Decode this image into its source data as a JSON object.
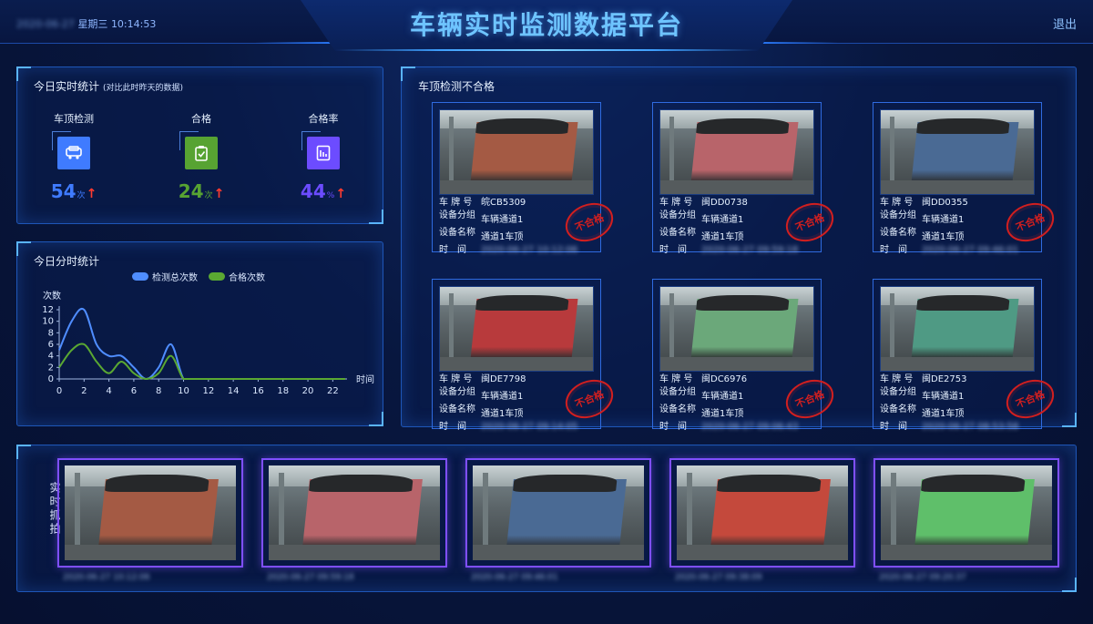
{
  "header": {
    "date": "2020-06-27",
    "weekday": "星期三",
    "time": "10:14:53",
    "title": "车辆实时监测数据平台",
    "logout": "退出"
  },
  "today_stats": {
    "title": "今日实时统计",
    "subtitle": "(对比此时昨天的数据)",
    "items": [
      {
        "label": "车顶检测",
        "value": "54",
        "unit": "次",
        "color": "#3f7bff",
        "icon": "truck-icon"
      },
      {
        "label": "合格",
        "value": "24",
        "unit": "次",
        "color": "#57a332",
        "icon": "clipboard-check-icon"
      },
      {
        "label": "合格率",
        "value": "44",
        "unit": "%",
        "color": "#6c4cff",
        "icon": "report-icon"
      }
    ]
  },
  "hourly_stats": {
    "title": "今日分时统计"
  },
  "chart_data": {
    "type": "line",
    "title": "",
    "ylabel": "次数",
    "xlabel": "时间",
    "x": [
      0,
      1,
      2,
      3,
      4,
      5,
      6,
      7,
      8,
      9,
      10,
      11,
      12,
      13,
      14,
      15,
      16,
      17,
      18,
      19,
      20,
      21,
      22,
      23
    ],
    "xticks": [
      "0",
      "2",
      "4",
      "6",
      "8",
      "10",
      "12",
      "14",
      "16",
      "18",
      "20",
      "22"
    ],
    "yticks": [
      "0",
      "2",
      "4",
      "6",
      "8",
      "10",
      "12"
    ],
    "ylim": [
      0,
      12
    ],
    "xlim": [
      0,
      23
    ],
    "series": [
      {
        "name": "检测总次数",
        "color": "#4f8dff",
        "values": [
          5,
          10,
          12,
          6,
          4,
          4,
          2,
          0,
          2,
          6,
          0,
          0,
          0,
          0,
          0,
          0,
          0,
          0,
          0,
          0,
          0,
          0,
          0,
          0
        ]
      },
      {
        "name": "合格次数",
        "color": "#5aa832",
        "values": [
          2,
          5,
          6,
          3,
          1,
          3,
          1,
          0,
          1,
          4,
          0,
          0,
          0,
          0,
          0,
          0,
          0,
          0,
          0,
          0,
          0,
          0,
          0,
          0
        ]
      }
    ],
    "legend": "top"
  },
  "inspection": {
    "title": "车顶检测不合格",
    "labels": {
      "plate": "车 牌 号",
      "group": "设备分组",
      "device": "设备名称",
      "time": "时　间"
    },
    "stamp": "不合格",
    "cards": [
      {
        "plate": "皖CB5309",
        "group": "车辆通道1",
        "device": "通道1车顶",
        "time": "2020-06-27 10:12:06",
        "color": "#a45a44"
      },
      {
        "plate": "闽DD0738",
        "group": "车辆通道1",
        "device": "通道1车顶",
        "time": "2020-06-27 09:59:18",
        "color": "#b8646a"
      },
      {
        "plate": "闽DD0355",
        "group": "车辆通道1",
        "device": "通道1车顶",
        "time": "2020-06-27 09:46:01",
        "color": "#4a6a94"
      },
      {
        "plate": "闽DE7798",
        "group": "车辆通道1",
        "device": "通道1车顶",
        "time": "2020-06-27 09:14:05",
        "color": "#b83a3c"
      },
      {
        "plate": "闽DC6976",
        "group": "车辆通道1",
        "device": "通道1车顶",
        "time": "2020-06-27 09:06:43",
        "color": "#6ba87a"
      },
      {
        "plate": "闽DE2753",
        "group": "车辆通道1",
        "device": "通道1车顶",
        "time": "2020-06-27 08:53:58",
        "color": "#4f9a84"
      }
    ]
  },
  "capture": {
    "title": "实时抓拍",
    "items": [
      {
        "time": "2020-06-27 10:12:06",
        "color": "#a45a44"
      },
      {
        "time": "2020-06-27 09:59:18",
        "color": "#b8646a"
      },
      {
        "time": "2020-06-27 09:46:01",
        "color": "#4a6a94"
      },
      {
        "time": "2020-06-27 09:38:09",
        "color": "#c4493c"
      },
      {
        "time": "2020-06-27 09:20:37",
        "color": "#5fbf6a"
      }
    ]
  }
}
